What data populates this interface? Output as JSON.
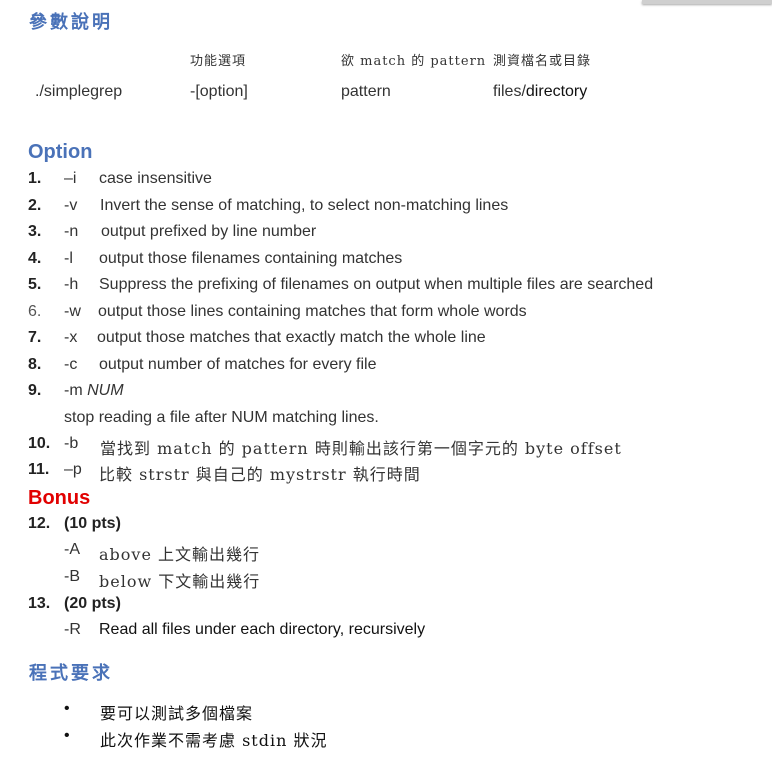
{
  "params_heading": "參數說明",
  "table": {
    "headers": [
      "功能選項",
      "欲 match 的 pattern",
      "測資檔名或目錄"
    ],
    "values": [
      "./simplegrep",
      "-[option]",
      "pattern",
      "files/",
      "directory"
    ]
  },
  "option_heading": "Option",
  "options": [
    {
      "num": "1.",
      "flag": "–i",
      "desc": "case insensitive"
    },
    {
      "num": "2.",
      "flag": "-v",
      "desc": "Invert the sense of matching, to select non-matching lines"
    },
    {
      "num": "3.",
      "flag": "-n",
      "desc": "output prefixed by line number"
    },
    {
      "num": "4.",
      "flag": "-l",
      "desc": "output those filenames containing matches"
    },
    {
      "num": "5.",
      "flag": "-h",
      "desc": "Suppress the prefixing of filenames on output when multiple files are searched"
    },
    {
      "num": "6.",
      "flag": "-w",
      "desc": "output those lines containing matches that form whole words"
    },
    {
      "num": "7.",
      "flag": "-x",
      "desc": "output those matches that exactly match the whole line"
    },
    {
      "num": "8.",
      "flag": "-c",
      "desc": "output number of matches for every file"
    },
    {
      "num": "9.",
      "flag": "-m",
      "arg": "NUM",
      "desc": "stop reading a file after NUM matching lines."
    },
    {
      "num": "10.",
      "flag": "-b",
      "desc": "當找到 match 的 pattern 時則輸出該行第一個字元的 byte offset"
    },
    {
      "num": "11.",
      "flag": "–p",
      "desc": "比較 strstr 與自己的 mystrstr 執行時間"
    }
  ],
  "bonus_heading": "Bonus",
  "bonus": [
    {
      "num": "12.",
      "pts": "(10 pts)",
      "items": [
        {
          "flag": "-A",
          "desc": "above 上文輸出幾行"
        },
        {
          "flag": "-B",
          "desc": "below 下文輸出幾行"
        }
      ]
    },
    {
      "num": "13.",
      "pts": "(20 pts)",
      "items": [
        {
          "flag": "-R",
          "desc": "Read all files under each directory, recursively"
        }
      ]
    }
  ],
  "req_heading": "程式要求",
  "requirements": [
    "要可以測試多個檔案",
    "此次作業不需考慮 stdin 狀況"
  ]
}
